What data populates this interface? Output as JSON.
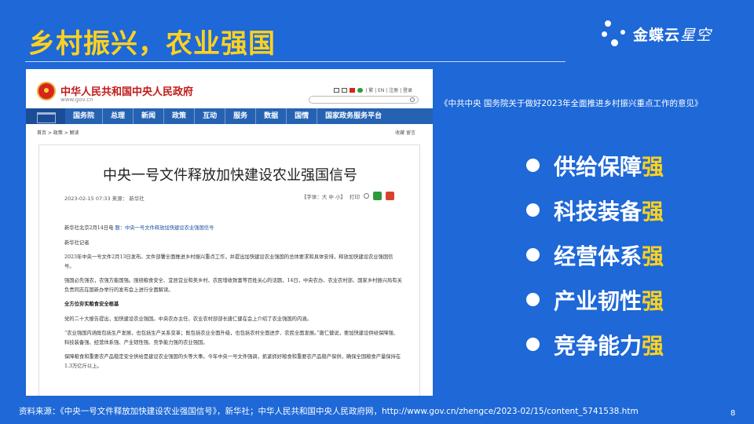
{
  "slide": {
    "title": "乡村振兴，农业强国",
    "logo": {
      "brand_bold": "金蝶云",
      "brand_light": "星空"
    },
    "source_note": "《中共中央 国务院关于做好2023年全面推进乡村振兴重点工作的意见》",
    "bullets": [
      {
        "text": "供给保障",
        "accent": "强"
      },
      {
        "text": "科技装备",
        "accent": "强"
      },
      {
        "text": "经营体系",
        "accent": "强"
      },
      {
        "text": "产业韧性",
        "accent": "强"
      },
      {
        "text": "竞争能力",
        "accent": "强"
      }
    ],
    "footer_source": "资料来源：《中央一号文件释放加快建设农业强国信号》，新华社；中华人民共和国中央人民政府网，http://www.gov.cn/zhengce/2023-02/15/content_5741538.htm",
    "page_number": "8"
  },
  "screenshot": {
    "site_name": "中华人民共和国中央人民政府",
    "site_url": "www.gov.cn",
    "header_tools": "| 繁 | EN | 注册 | 登录",
    "nav": [
      "国务院",
      "总理",
      "新闻",
      "政策",
      "互动",
      "服务",
      "数据",
      "国情",
      "国家政务服务平台"
    ],
    "breadcrumb": "首页 > 政策 > 解读",
    "page_tools": "收藏  留言",
    "article": {
      "title": "中央一号文件释放加快建设农业强国信号",
      "meta": "2023-02-15 07:33   来源：  新华社",
      "options": "【字体：大  中  小】",
      "print": "打印",
      "lead_prefix": "新华社北京2月14日电",
      "lead_title": "题：中央一号文件释放加快建设农业强国信号",
      "reporter": "新华社记者",
      "paragraphs": [
        "2023年中央一号文件2月13日发布。文件部署全面推进乡村振兴重点工作，并提出加快建设农业强国的总体要求和具体安排，释放加快建设农业强国信号。",
        "强国必先强农，农强方能国强。围绕粮食安全、宜居宜业和美乡村、农民增收致富等百姓关心的话题，14日，中央农办、农业农村部、国家乡村振兴局有关负责同志在国新办举行的发布会上进行全面解读。",
        "全方位夯实粮食安全根基",
        "党的二十大报告提出，加快建设农业强国。中央农办主任、农业农村部部长唐仁健在会上介绍了农业强国的内涵。",
        "“农业强国内涵既包括生产发展，也包括生产关系变革；既包括农业全面升级，也包括农村全面进步、农民全面发展。”唐仁健说，要加快建设供给保障强、科技装备强、经营体系强、产业韧性强、竞争能力强的农业强国。",
        "保障粮食和重要农产品稳定安全供给是建设农业强国的头等大事。今年中央一号文件强调，抓紧抓好粮食和重要农产品稳产保供，确保全国粮食产量保持在1.3万亿斤以上。"
      ]
    }
  }
}
